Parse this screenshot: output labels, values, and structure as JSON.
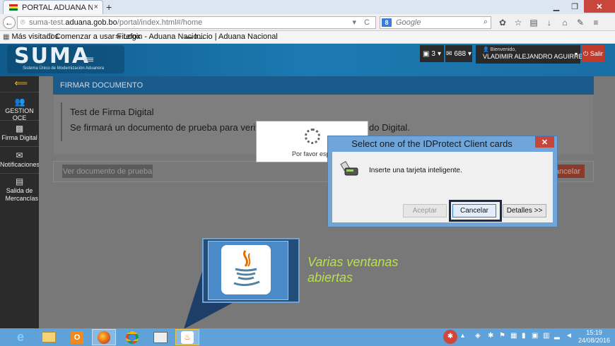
{
  "browser": {
    "tab_title": "PORTAL ADUANA NACIO...",
    "tab_close": "×",
    "new_tab": "+",
    "url_host": "suma-test.",
    "url_domain": "aduana.gob.bo",
    "url_path": "/portal/index.html#/home",
    "url_icons": "▾ C",
    "search_engine": "8",
    "search_placeholder": "Google",
    "bookmarks": [
      "Más visitados",
      "Comenzar a usar Firefox",
      "Login - Aduana Nacio...",
      "Inicio | Aduana Nacional"
    ]
  },
  "header": {
    "logo": "SUMA",
    "logo_sub": "Sistema Único de Modernización Aduanera",
    "notifications_count": "3",
    "mail_count": "688",
    "welcome": "Bienvenido,",
    "user_name": "VLADIMIR ALEJANDRO AGUIRRE ...",
    "logout": "Salir"
  },
  "sidebar": {
    "items": [
      {
        "label": "GESTION OCE",
        "icon": "users-icon"
      },
      {
        "label": "Firma Digital",
        "icon": "qr-icon"
      },
      {
        "label": "Notificaciones",
        "icon": "envelope-icon"
      },
      {
        "label": "Salida de Mercancías",
        "icon": "document-icon"
      }
    ]
  },
  "panel": {
    "header": "FIRMAR DOCUMENTO",
    "title": "Test de Firma Digital",
    "desc_start": "Se firmará un documento de prueba para verificar",
    "desc_end": "do Digital.",
    "view_button": "Ver documento de prueba",
    "cancel_button": "ancelar"
  },
  "loading": {
    "text": "Por favor espe"
  },
  "dialog": {
    "title": "Select one of the IDProtect Client cards",
    "message": "Inserte una tarjeta inteligente.",
    "accept": "Aceptar",
    "cancel": "Cancelar",
    "details": "Detalles >>"
  },
  "annotation": {
    "text_line1": "Varias ventanas",
    "text_line2": "abiertas"
  },
  "taskbar": {
    "time": "15:19",
    "date": "24/08/2016"
  },
  "colors": {
    "header_blue": "#1a6fa5",
    "panel_head": "#1a5b8c",
    "logout_red": "#c0392b",
    "annotation_green": "#b8e04a",
    "taskbar": "#5fa2d9"
  }
}
